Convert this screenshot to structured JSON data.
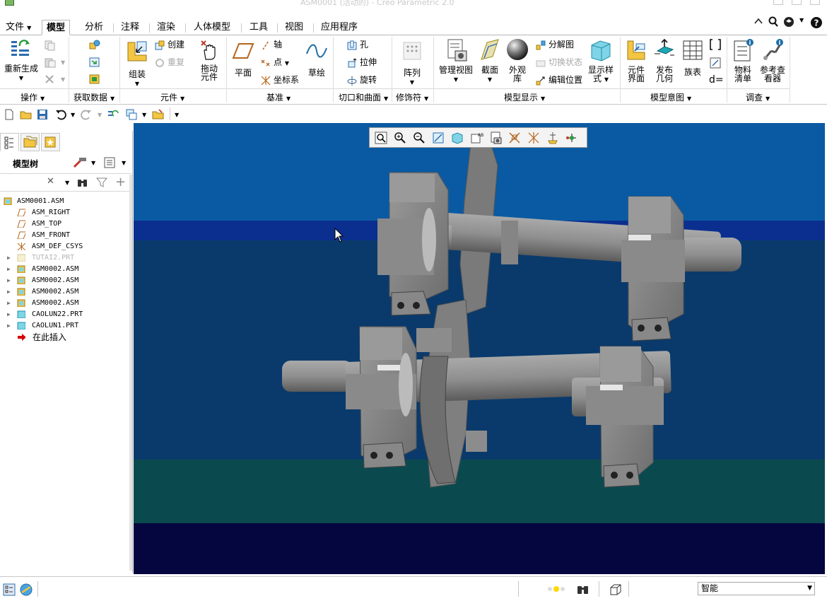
{
  "window": {
    "title": "ASM0001 (活动的) - Creo Parametric 2.0"
  },
  "menu": {
    "file": "文件",
    "tabs": [
      "模型",
      "分析",
      "注释",
      "渲染",
      "人体模型",
      "工具",
      "视图",
      "应用程序"
    ],
    "active_tab": "模型"
  },
  "ribbon": {
    "groups": {
      "operations": "操作",
      "get_data": "获取数据",
      "components": "元件",
      "datum": "基准",
      "cut_surface": "切口和曲面",
      "modifiers": "修饰符",
      "model_display": "模型显示",
      "model_intent": "模型意图",
      "investigate": "调查"
    },
    "regenerate": "重新生成",
    "assemble": "组装",
    "create": "创建",
    "repeat": "重复",
    "drag": [
      "拖动",
      "元件"
    ],
    "plane": "平面",
    "axis": "轴",
    "point": "点",
    "csys": "坐标系",
    "sketch": "草绘",
    "hole": "孔",
    "extrude": "拉伸",
    "revolve": "旋转",
    "pattern": "阵列",
    "manage_views": "管理视图",
    "section": "截面",
    "appearance": [
      "外观",
      "库"
    ],
    "explode": "分解图",
    "toggle_state": "切换状态",
    "edit_position": "编辑位置",
    "display_style": [
      "显示样",
      "式"
    ],
    "component_interface": [
      "元件",
      "界面"
    ],
    "publish_geometry": [
      "发布",
      "几何"
    ],
    "family_table": "族表",
    "d_equals": "d=",
    "bom": [
      "物料",
      "清单"
    ],
    "reference_viewer": [
      "参考查",
      "看器"
    ]
  },
  "model_tree": {
    "title": "模型树",
    "search_placeholder": "",
    "items": [
      {
        "label": "ASM0001.ASM",
        "type": "asm-root",
        "expandable": false,
        "dim": false
      },
      {
        "label": "ASM_RIGHT",
        "type": "plane",
        "expandable": false,
        "dim": false
      },
      {
        "label": "ASM_TOP",
        "type": "plane",
        "expandable": false,
        "dim": false
      },
      {
        "label": "ASM_FRONT",
        "type": "plane",
        "expandable": false,
        "dim": false
      },
      {
        "label": "ASM_DEF_CSYS",
        "type": "csys",
        "expandable": false,
        "dim": false
      },
      {
        "label": "TUTAI2.PRT",
        "type": "part-hidden",
        "expandable": true,
        "dim": true
      },
      {
        "label": "ASM0002.ASM",
        "type": "asm",
        "expandable": true,
        "dim": false
      },
      {
        "label": "ASM0002.ASM",
        "type": "asm",
        "expandable": true,
        "dim": false
      },
      {
        "label": "ASM0002.ASM",
        "type": "asm",
        "expandable": true,
        "dim": false
      },
      {
        "label": "ASM0002.ASM",
        "type": "asm",
        "expandable": true,
        "dim": false
      },
      {
        "label": "CAOLUN22.PRT",
        "type": "part",
        "expandable": true,
        "dim": false
      },
      {
        "label": "CAOLUN1.PRT",
        "type": "part",
        "expandable": true,
        "dim": false
      },
      {
        "label": "在此插入",
        "type": "insert",
        "expandable": false,
        "dim": false
      }
    ]
  },
  "status": {
    "filter_value": "智能"
  },
  "colors": {
    "accent": "#2b6cb0",
    "viewport_top": "#0a5aa3",
    "viewport_band": "#0a2f8f",
    "viewport_mid": "#0a3a6b",
    "viewport_teal": "#0a4a4f",
    "viewport_bottom": "#05053f",
    "model_gray": "#8a8a8a",
    "insert_arrow": "#d80000"
  }
}
